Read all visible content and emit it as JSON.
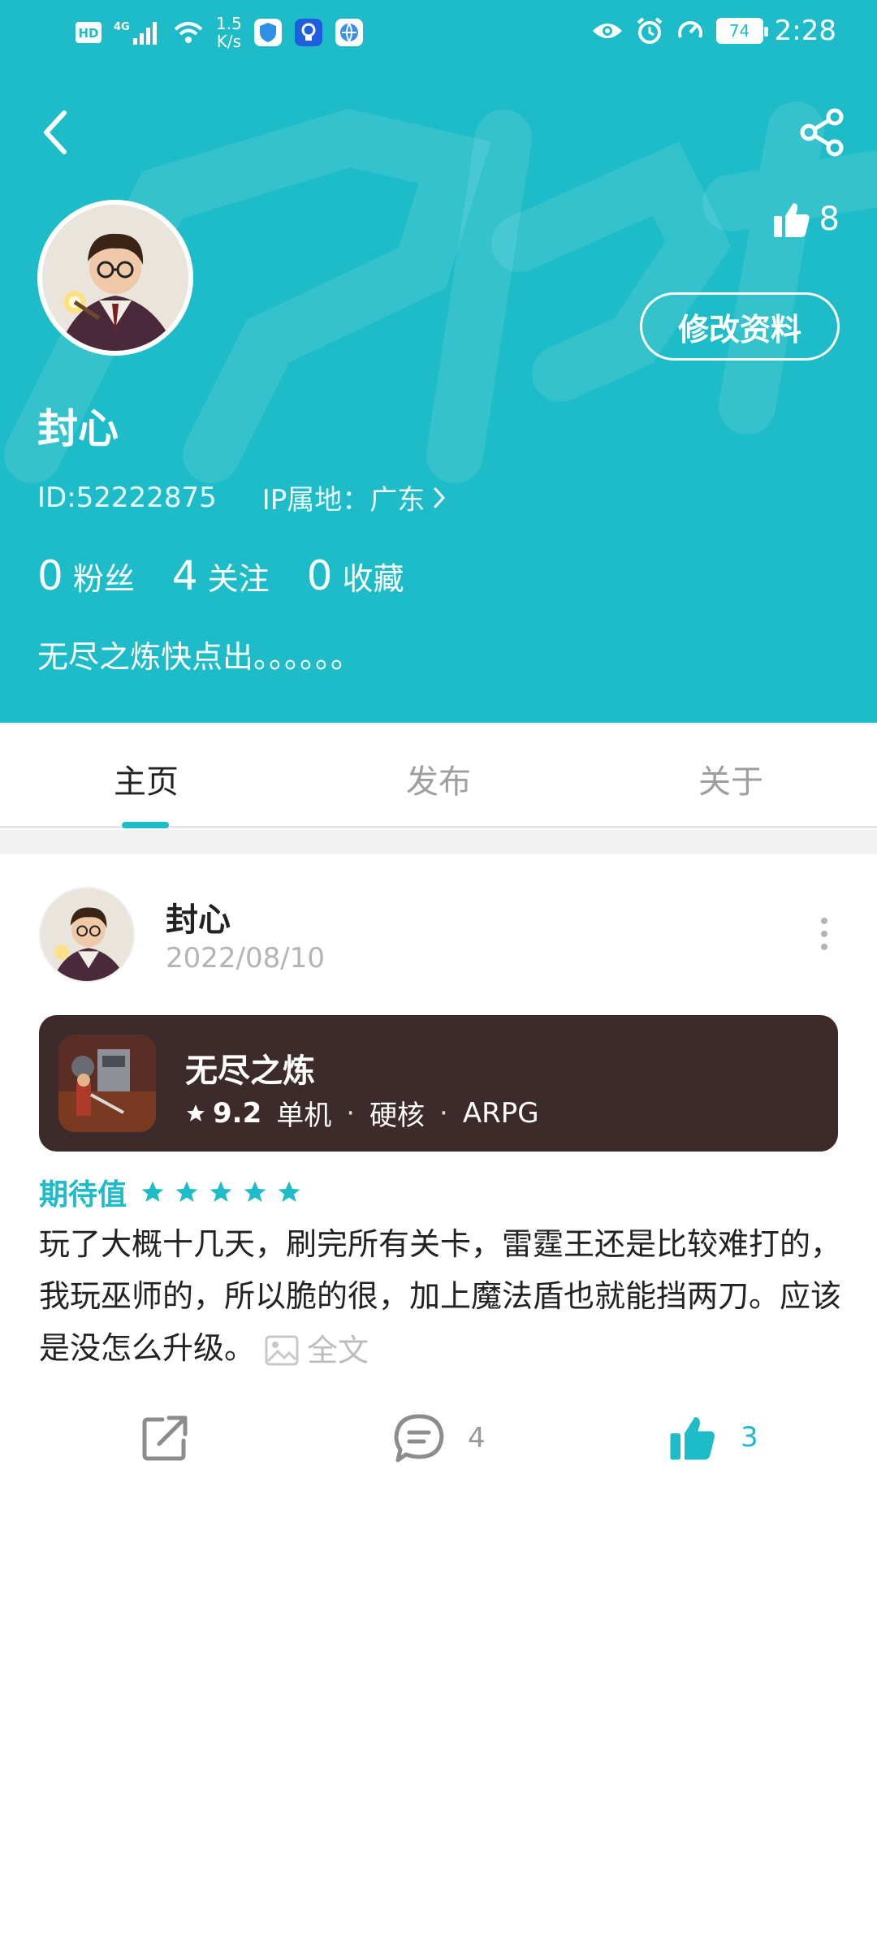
{
  "status_bar": {
    "net_speed_value": "1.5",
    "net_speed_unit": "K/s",
    "battery": "74",
    "time": "2:28"
  },
  "profile": {
    "likes": "8",
    "edit_label": "修改资料",
    "name": "封心",
    "id": "ID:52222875",
    "ip_location": "IP属地：广东",
    "stats": [
      {
        "count": "0",
        "label": "粉丝"
      },
      {
        "count": "4",
        "label": "关注"
      },
      {
        "count": "0",
        "label": "收藏"
      }
    ],
    "bio": "无尽之炼快点出。。。。。。"
  },
  "tabs": [
    {
      "label": "主页",
      "active": true
    },
    {
      "label": "发布",
      "active": false
    },
    {
      "label": "关于",
      "active": false
    }
  ],
  "post": {
    "author": "封心",
    "date": "2022/08/10",
    "game": {
      "name": "无尽之炼",
      "score": "9.2",
      "tags": [
        "单机",
        "硬核",
        "ARPG"
      ]
    },
    "expect_label": "期待值",
    "expect_stars": 5,
    "text": "玩了大概十几天，刷完所有关卡，雷霆王还是比较难打的，我玩巫师的，所以脆的很，加上魔法盾也就能挡两刀。应该是没怎么升级。",
    "full_text_label": "全文",
    "comments": "4",
    "likes": "3"
  },
  "colors": {
    "accent": "#1dbcc8",
    "game_card": "#3d2a2a"
  }
}
